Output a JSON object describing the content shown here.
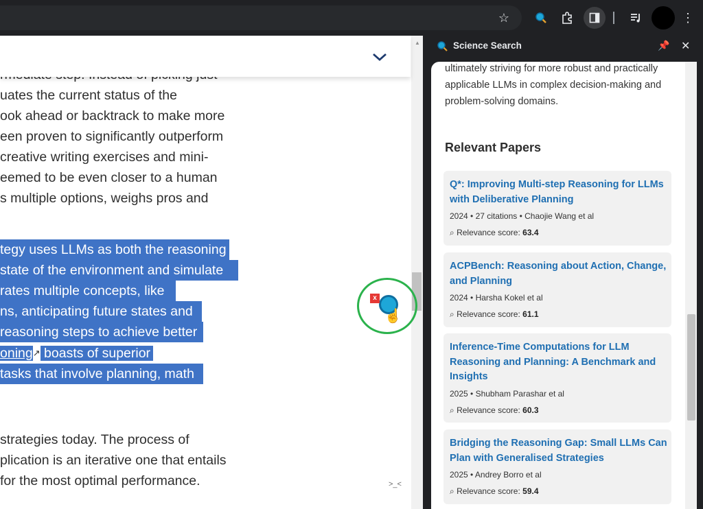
{
  "browser": {
    "toolbar_icons": [
      "star-icon",
      "science-search-extension-icon",
      "puzzle-icon",
      "side-panel-icon",
      "media-queue-icon",
      "menu-icon"
    ]
  },
  "article": {
    "lines": [
      "rmediate step. Instead of picking just",
      "uates the current status of the",
      "ook ahead or backtrack to make more",
      "een proven to significantly outperform",
      "creative writing exercises and mini-",
      "eemed to be even closer to a human",
      "s multiple options, weighs pros and"
    ],
    "highlighted_lines": [
      "tegy uses LLMs as both the reasoning",
      "state of the environment and simulate",
      "rates multiple concepts, like",
      "ns, anticipating future states and",
      "reasoning steps to achieve better"
    ],
    "link_text": "oning",
    "after_link_text": " boasts of superior",
    "highlighted_last": "tasks that involve planning, math",
    "bottom_lines": [
      " strategies today. The process of",
      "plication is an iterative one that entails",
      " for the most optimal performance."
    ],
    "mini_icon_text": ">_<"
  },
  "side_panel": {
    "title": "Science Search",
    "summary": "ultimately striving for more robust and practically applicable LLMs in complex decision-making and problem-solving domains.",
    "relevant_heading": "Relevant Papers",
    "score_label": "Relevance score:",
    "papers": [
      {
        "title": "Q*: Improving Multi-step Reasoning for LLMs with Deliberative Planning",
        "meta": "2024 • 27 citations • Chaojie Wang et al",
        "score": "63.4"
      },
      {
        "title": "ACPBench: Reasoning about Action, Change, and Planning",
        "meta": "2024 • Harsha Kokel et al",
        "score": "61.1"
      },
      {
        "title": "Inference-Time Computations for LLM Reasoning and Planning: A Benchmark and Insights",
        "meta": "2025 • Shubham Parashar et al",
        "score": "60.3"
      },
      {
        "title": "Bridging the Reasoning Gap: Small LLMs Can Plan with Generalised Strategies",
        "meta": "2025 • Andrey Borro et al",
        "score": "59.4"
      }
    ]
  }
}
